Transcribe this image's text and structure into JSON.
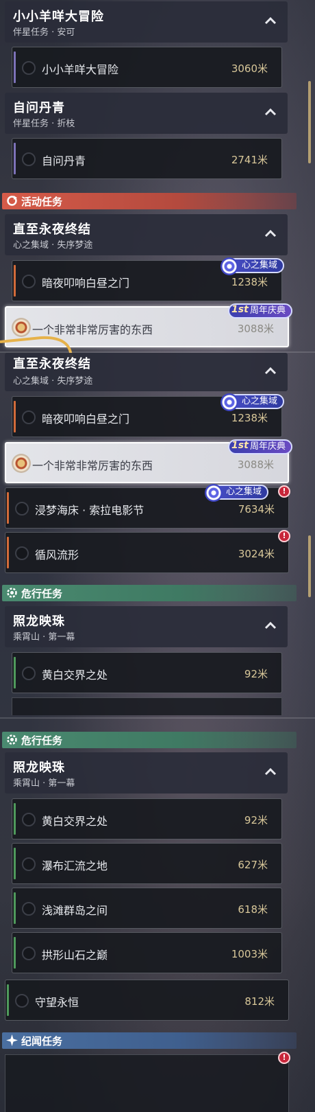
{
  "groups": {
    "g1": {
      "title": "小小羊咩大冒险",
      "subtitle": "伴星任务 · 安可"
    },
    "g2": {
      "title": "自问丹青",
      "subtitle": "伴星任务 · 折枝"
    },
    "g3": {
      "title": "直至永夜终结",
      "subtitle": "心之集域 · 失序梦途"
    },
    "g3b": {
      "title": "直至永夜终结",
      "subtitle": "心之集域 · 失序梦途"
    },
    "g4": {
      "title": "照龙映珠",
      "subtitle": "乘霄山 · 第一幕"
    },
    "g4b": {
      "title": "照龙映珠",
      "subtitle": "乘霄山 · 第一幕"
    }
  },
  "rows": {
    "r1": {
      "label": "小小羊咩大冒险",
      "distance": "3060米"
    },
    "r2": {
      "label": "自问丹青",
      "distance": "2741米"
    },
    "r3": {
      "label": "暗夜叩响白昼之门",
      "distance": "1238米"
    },
    "r4": {
      "label": "一个非常非常厉害的东西",
      "distance": "3088米"
    },
    "r5": {
      "label": "暗夜叩响白昼之门",
      "distance": "1238米"
    },
    "r6": {
      "label": "一个非常非常厉害的东西",
      "distance": "3088米"
    },
    "r7": {
      "label": "浸梦海床 · 索拉电影节",
      "distance": "7634米"
    },
    "r8": {
      "label": "循风流形",
      "distance": "3024米"
    },
    "r9": {
      "label": "黄白交界之处",
      "distance": "92米"
    },
    "r10": {
      "label": "黄白交界之处",
      "distance": "92米"
    },
    "r11": {
      "label": "瀑布汇流之地",
      "distance": "627米"
    },
    "r12": {
      "label": "浅滩群岛之间",
      "distance": "618米"
    },
    "r13": {
      "label": "拱形山石之巅",
      "distance": "1003米"
    },
    "r14": {
      "label": "守望永恒",
      "distance": "812米"
    }
  },
  "banners": {
    "activity": "活动任务",
    "danger": "危行任务",
    "danger2": "危行任务",
    "chronicle": "纪闻任务"
  },
  "tags": {
    "heart_domain": "心之集域",
    "anniversary": "周年庆典",
    "anniversary_ver": "1st"
  },
  "colors": {
    "activity_banner": "#d65b49",
    "danger_banner": "#3f7a63",
    "chronicle_banner": "#3f5f8e",
    "bar_purple": "#7d72b8",
    "bar_orange": "#d26b3a",
    "bar_green": "#4f9a5c",
    "distance_text": "#d9c89a"
  },
  "icons": [
    "chevron-up-icon",
    "activity-refresh-icon",
    "danger-gear-icon",
    "chronicle-star-icon",
    "swirl-icon",
    "warning-icon",
    "target-icon"
  ]
}
